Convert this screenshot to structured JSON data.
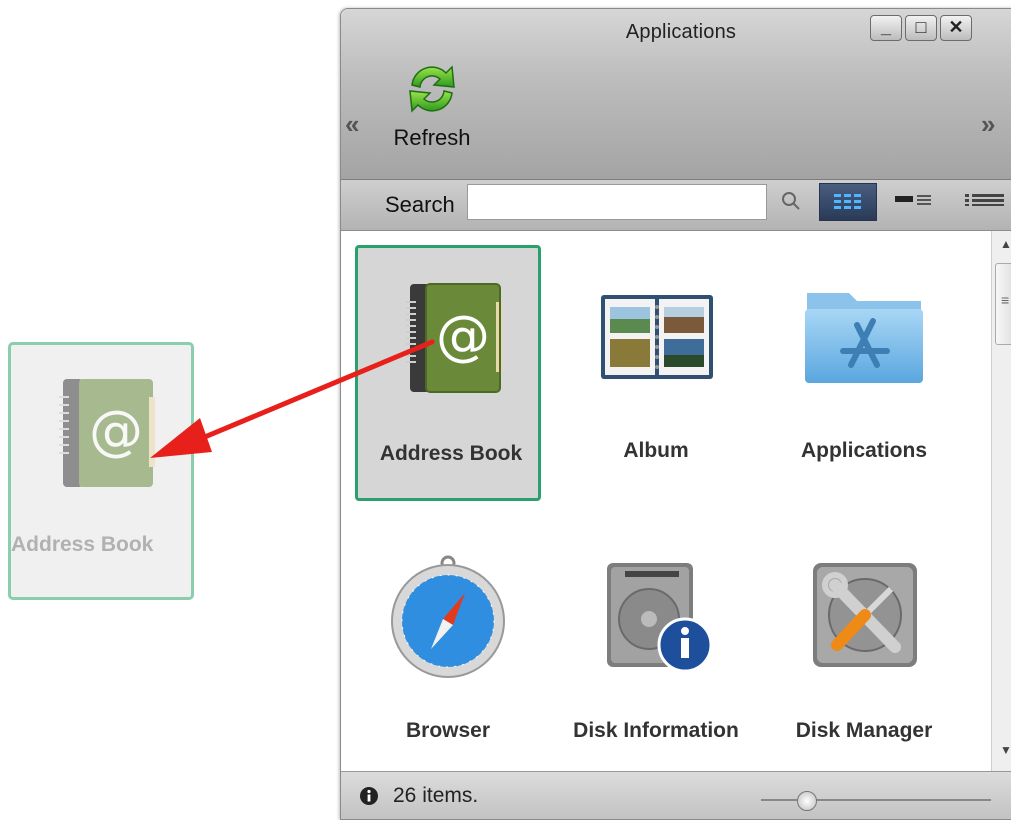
{
  "window": {
    "title": "Applications",
    "minimize_glyph": "_",
    "maximize_glyph": "□",
    "close_glyph": "✕"
  },
  "toolbar": {
    "prev_glyph": "«",
    "next_glyph": "»",
    "refresh_label": "Refresh",
    "refresh_icon": "refresh-icon"
  },
  "search": {
    "label": "Search",
    "value": "",
    "placeholder": ""
  },
  "view_modes": [
    "grid",
    "detail",
    "list"
  ],
  "apps": [
    {
      "label": "Address Book",
      "icon": "address-book-icon",
      "selected": true
    },
    {
      "label": "Album",
      "icon": "album-icon"
    },
    {
      "label": "Applications",
      "icon": "applications-folder-icon"
    },
    {
      "label": "Browser",
      "icon": "compass-icon"
    },
    {
      "label": "Disk Information",
      "icon": "disk-information-icon"
    },
    {
      "label": "Disk Manager",
      "icon": "disk-manager-icon"
    }
  ],
  "status": {
    "text": "26 items.",
    "zoom_fraction": 0.2
  },
  "drag_ghost": {
    "label": "Address Book"
  },
  "colors": {
    "selection_border": "#2aa16d",
    "drag_arrow": "#e8201c",
    "address_book_cover": "#6a8a3a"
  }
}
